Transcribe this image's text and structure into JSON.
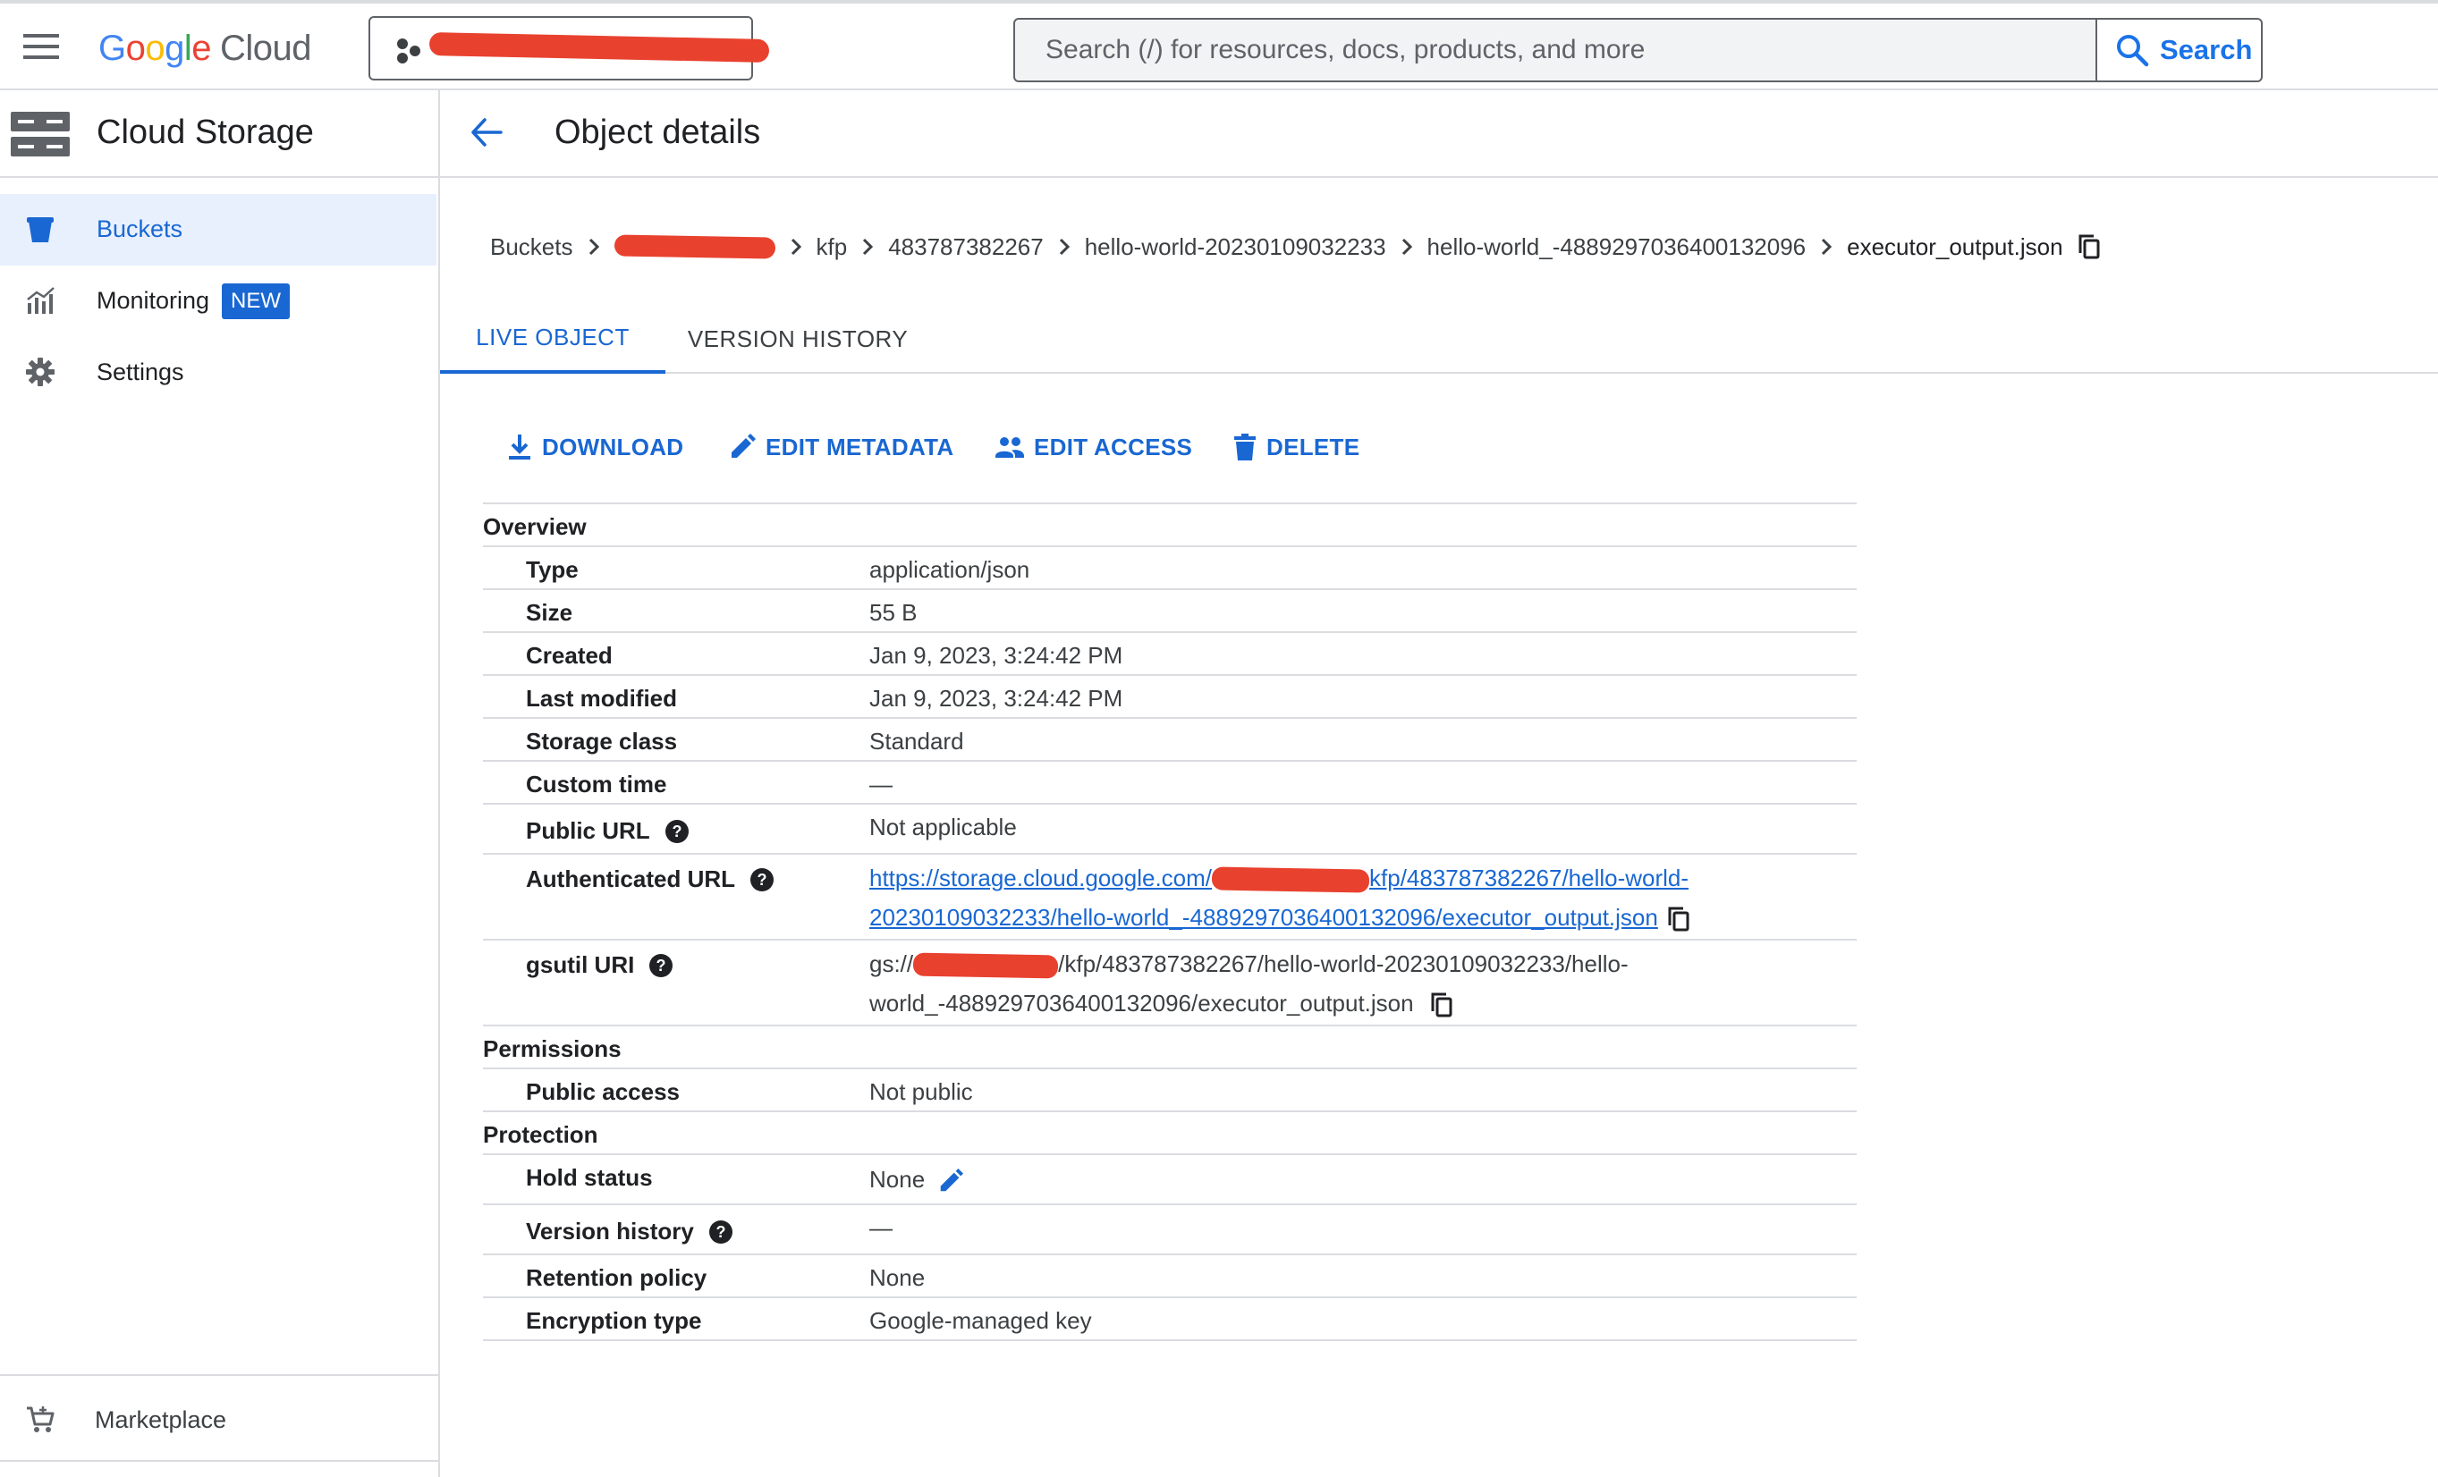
{
  "topbar": {
    "logo_google": "Google",
    "logo_cloud": "Cloud",
    "search_placeholder": "Search (/) for resources, docs, products, and more",
    "search_button": "Search"
  },
  "sidebar": {
    "title": "Cloud Storage",
    "items": [
      {
        "label": "Buckets"
      },
      {
        "label": "Monitoring",
        "badge": "NEW"
      },
      {
        "label": "Settings"
      }
    ],
    "footer": "Marketplace"
  },
  "page": {
    "title": "Object details"
  },
  "breadcrumb": {
    "root": "Buckets",
    "items": [
      "kfp",
      "483787382267",
      "hello-world-20230109032233",
      "hello-world_-4889297036400132096"
    ],
    "current": "executor_output.json"
  },
  "tabs": [
    "LIVE OBJECT",
    "VERSION HISTORY"
  ],
  "actions": [
    "DOWNLOAD",
    "EDIT METADATA",
    "EDIT ACCESS",
    "DELETE"
  ],
  "details": {
    "overview": {
      "title": "Overview",
      "type_k": "Type",
      "type_v": "application/json",
      "size_k": "Size",
      "size_v": "55 B",
      "created_k": "Created",
      "created_v": "Jan 9, 2023, 3:24:42 PM",
      "modified_k": "Last modified",
      "modified_v": "Jan 9, 2023, 3:24:42 PM",
      "class_k": "Storage class",
      "class_v": "Standard",
      "custom_k": "Custom time",
      "custom_v": "—",
      "public_k": "Public URL",
      "public_v": "Not applicable",
      "auth_k": "Authenticated URL",
      "auth_prefix": "https://storage.cloud.google.com/",
      "auth_suffix_1": "kfp/483787382267/hello-world-",
      "auth_suffix_2": "20230109032233/hello-world_-4889297036400132096/executor_output.json",
      "gsutil_k": "gsutil URI",
      "gsutil_prefix": "gs://",
      "gsutil_suffix_1": "/kfp/483787382267/hello-world-20230109032233/hello-",
      "gsutil_suffix_2": "world_-4889297036400132096/executor_output.json"
    },
    "permissions": {
      "title": "Permissions",
      "access_k": "Public access",
      "access_v": "Not public"
    },
    "protection": {
      "title": "Protection",
      "hold_k": "Hold status",
      "hold_v": "None",
      "version_k": "Version history",
      "version_v": "—",
      "retention_k": "Retention policy",
      "retention_v": "None",
      "encryption_k": "Encryption type",
      "encryption_v": "Google-managed key"
    }
  },
  "colors": {
    "accent": "#1967d2",
    "active_nav_bg": "#e8f0fe",
    "divider": "#dadce0",
    "redaction": "#e8412e"
  }
}
